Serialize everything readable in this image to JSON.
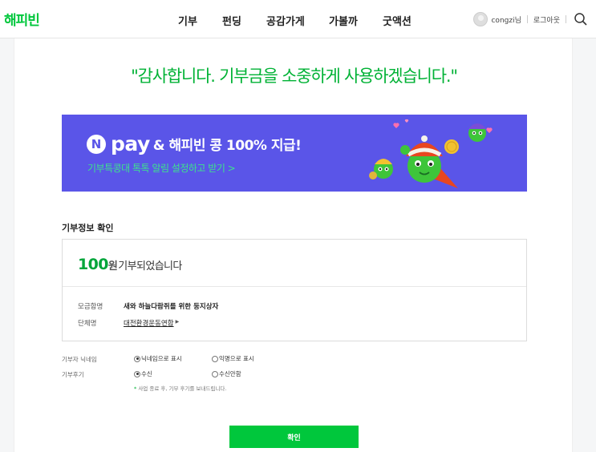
{
  "header": {
    "logo": "해피빈",
    "nav": [
      "기부",
      "펀딩",
      "공감가게",
      "가볼까",
      "굿액션"
    ],
    "username": "congzi님",
    "logout": "로그아웃"
  },
  "thanks_message": "\"감사합니다. 기부금을 소중하게 사용하겠습니다.\"",
  "banner": {
    "n_mark": "N",
    "pay_word": "pay",
    "headline": "& 해피빈 콩 100% 지급!",
    "sub": "기부특콩대 톡톡 알림 설정하고 받기 >"
  },
  "donation_info": {
    "section_title": "기부정보 확인",
    "amount": "100",
    "unit": "원",
    "done_text": "기부되었습니다",
    "fundraising_label": "모금함명",
    "fundraising_value": "새와 하늘다람쥐를 위한 둥지상자",
    "org_label": "단체명",
    "org_value": "대전환경운동연합"
  },
  "options": {
    "nickname_label": "기부자 닉네임",
    "nickname_opt1": "닉네임으로 표시",
    "nickname_opt2": "익명으로 표시",
    "review_label": "기부후기",
    "review_opt1": "수신",
    "review_opt2": "수신안함",
    "notice_star": "*",
    "notice": "사업 종료 후, 기부 후기를 보내드립니다."
  },
  "confirm_label": "확인",
  "colors": {
    "brand_green": "#00c73c",
    "banner_purple": "#5a55e8",
    "thanks_green": "#00b235"
  }
}
